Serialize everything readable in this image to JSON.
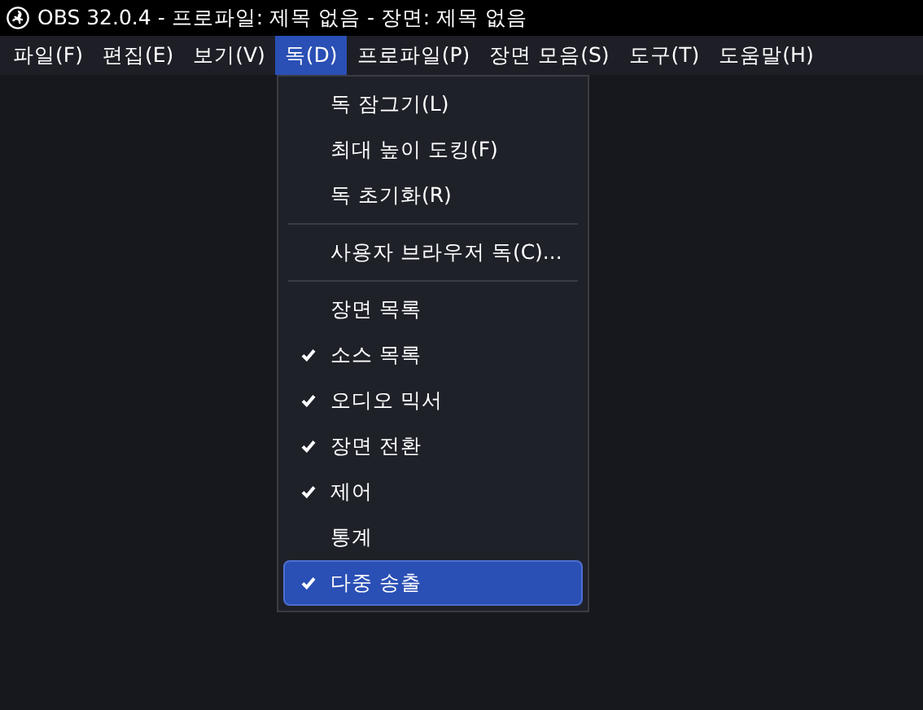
{
  "window": {
    "title": "OBS 32.0.4 - 프로파일: 제목 없음 - 장면: 제목 없음"
  },
  "menubar": [
    {
      "label": "파일(F)",
      "selected": false
    },
    {
      "label": "편집(E)",
      "selected": false
    },
    {
      "label": "보기(V)",
      "selected": false
    },
    {
      "label": "독(D)",
      "selected": true
    },
    {
      "label": "프로파일(P)",
      "selected": false
    },
    {
      "label": "장면 모음(S)",
      "selected": false
    },
    {
      "label": "도구(T)",
      "selected": false
    },
    {
      "label": "도움말(H)",
      "selected": false
    }
  ],
  "menu": [
    {
      "kind": "action",
      "label": "독 잠그기(L)",
      "selected": false
    },
    {
      "kind": "action",
      "label": "최대 높이 도킹(F)",
      "selected": false
    },
    {
      "kind": "action",
      "label": "독 초기화(R)",
      "selected": false
    },
    {
      "kind": "separator"
    },
    {
      "kind": "action",
      "label": "사용자 브라우저 독(C)...",
      "selected": false
    },
    {
      "kind": "separator"
    },
    {
      "kind": "toggle",
      "label": "장면 목록",
      "checked": false,
      "selected": false
    },
    {
      "kind": "toggle",
      "label": "소스 목록",
      "checked": true,
      "selected": false
    },
    {
      "kind": "toggle",
      "label": "오디오 믹서",
      "checked": true,
      "selected": false
    },
    {
      "kind": "toggle",
      "label": "장면 전환",
      "checked": true,
      "selected": false
    },
    {
      "kind": "toggle",
      "label": "제어",
      "checked": true,
      "selected": false
    },
    {
      "kind": "toggle",
      "label": "통계",
      "checked": false,
      "selected": false
    },
    {
      "kind": "toggle",
      "label": "다중 송출",
      "checked": true,
      "selected": true
    }
  ]
}
